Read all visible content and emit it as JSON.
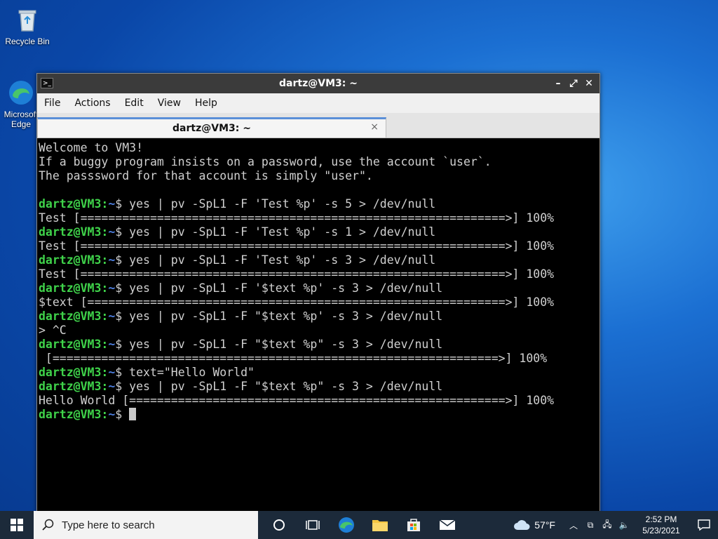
{
  "desktop": {
    "recycle_bin": "Recycle Bin",
    "edge_line1": "Microsoft",
    "edge_line2": "Edge"
  },
  "window": {
    "title": "dartz@VM3: ~",
    "menu": [
      "File",
      "Actions",
      "Edit",
      "View",
      "Help"
    ],
    "tab_label": "dartz@VM3: ~",
    "tab_close": "×"
  },
  "terminal": {
    "lines": [
      {
        "type": "text",
        "text": "Welcome to VM3!"
      },
      {
        "type": "text",
        "text": "If a buggy program insists on a password, use the account `user`."
      },
      {
        "type": "text",
        "text": "The passsword for that account is simply \"user\"."
      },
      {
        "type": "text",
        "text": ""
      },
      {
        "type": "cmd",
        "user": "dartz@VM3",
        "path": "~",
        "cmd": " yes | pv -SpL1 -F 'Test %p' -s 5 > /dev/null"
      },
      {
        "type": "text",
        "text": "Test [=============================================================>] 100%"
      },
      {
        "type": "cmd",
        "user": "dartz@VM3",
        "path": "~",
        "cmd": " yes | pv -SpL1 -F 'Test %p' -s 1 > /dev/null"
      },
      {
        "type": "text",
        "text": "Test [=============================================================>] 100%"
      },
      {
        "type": "cmd",
        "user": "dartz@VM3",
        "path": "~",
        "cmd": " yes | pv -SpL1 -F 'Test %p' -s 3 > /dev/null"
      },
      {
        "type": "text",
        "text": "Test [=============================================================>] 100%"
      },
      {
        "type": "cmd",
        "user": "dartz@VM3",
        "path": "~",
        "cmd": " yes | pv -SpL1 -F '$text %p' -s 3 > /dev/null"
      },
      {
        "type": "text",
        "text": "$text [============================================================>] 100%"
      },
      {
        "type": "cmd",
        "user": "dartz@VM3",
        "path": "~",
        "cmd": " yes | pv -SpL1 -F \"$text %p' -s 3 > /dev/null"
      },
      {
        "type": "text",
        "text": "> ^C"
      },
      {
        "type": "cmd",
        "user": "dartz@VM3",
        "path": "~",
        "cmd": " yes | pv -SpL1 -F \"$text %p\" -s 3 > /dev/null"
      },
      {
        "type": "text",
        "text": " [================================================================>] 100%"
      },
      {
        "type": "cmd",
        "user": "dartz@VM3",
        "path": "~",
        "cmd": " text=\"Hello World\""
      },
      {
        "type": "cmd",
        "user": "dartz@VM3",
        "path": "~",
        "cmd": " yes | pv -SpL1 -F \"$text %p\" -s 3 > /dev/null"
      },
      {
        "type": "text",
        "text": "Hello World [======================================================>] 100%"
      },
      {
        "type": "prompt",
        "user": "dartz@VM3",
        "path": "~",
        "cmd": " "
      }
    ]
  },
  "taskbar": {
    "search_placeholder": "Type here to search",
    "weather_temp": "57°F",
    "time": "2:52 PM",
    "date": "5/23/2021"
  },
  "colors": {
    "prompt_user": "#3fd24a",
    "prompt_path": "#4d7fe0",
    "taskbar_bg": "#1c2a3a"
  }
}
